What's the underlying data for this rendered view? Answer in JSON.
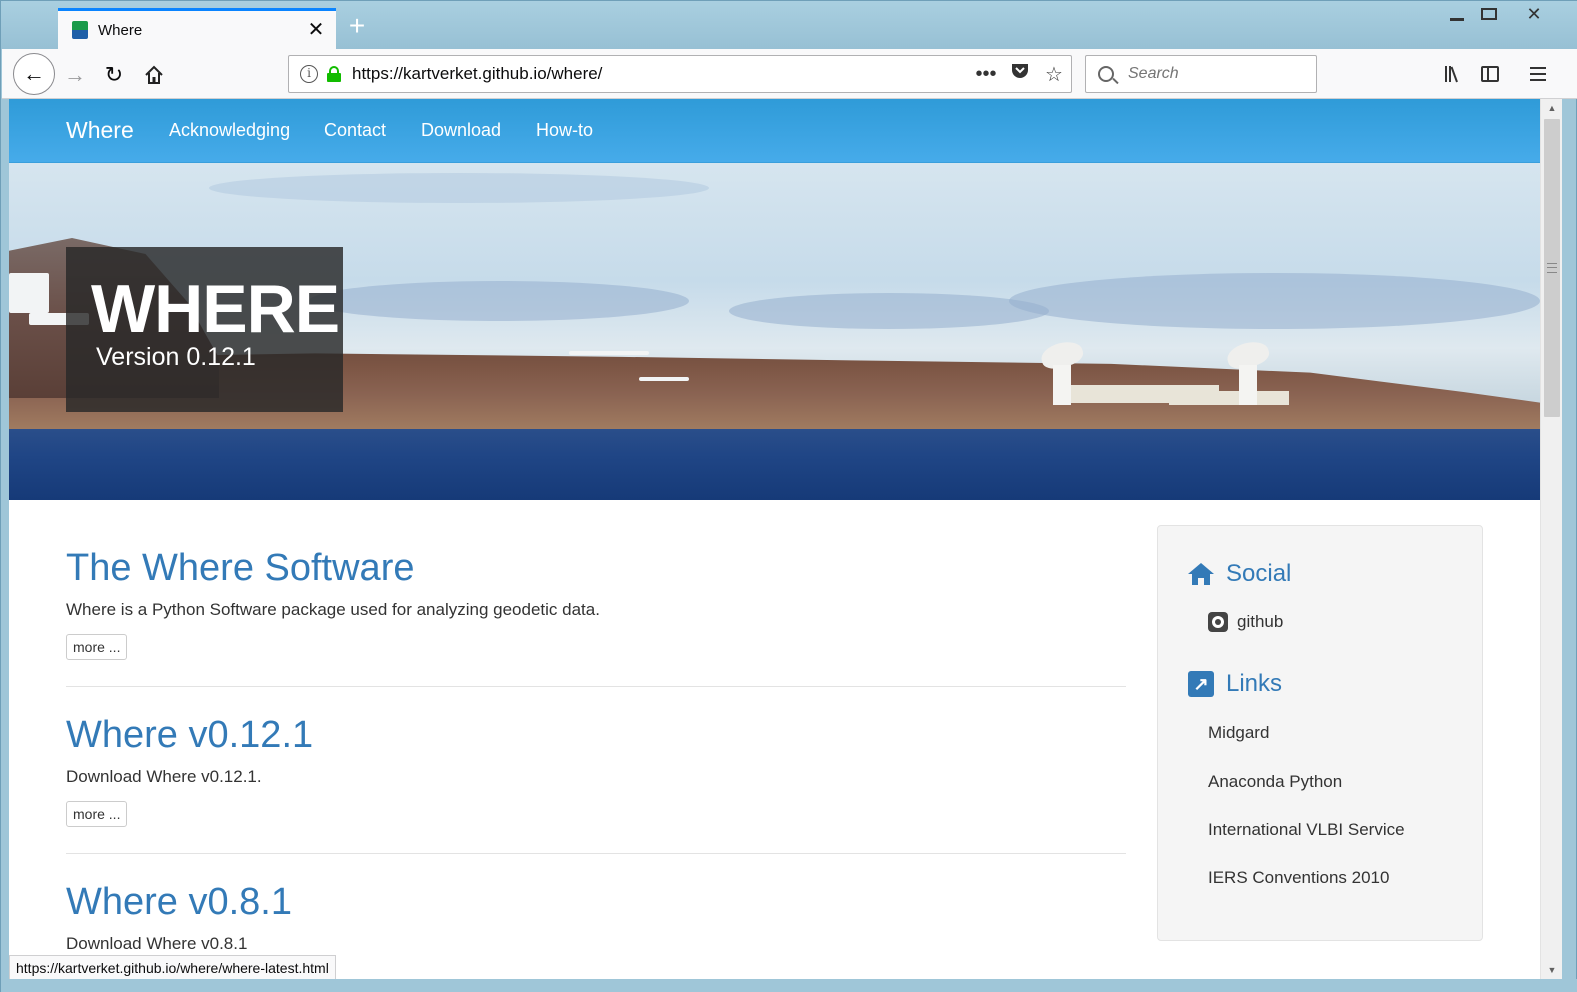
{
  "browser": {
    "tab_title": "Where",
    "tab_close": "✕",
    "new_tab": "+",
    "url": "https://kartverket.github.io/where/",
    "search_placeholder": "Search",
    "page_actions": "•••",
    "status_url": "https://kartverket.github.io/where/where-latest.html"
  },
  "site": {
    "brand": "Where",
    "nav": [
      "Acknowledging",
      "Contact",
      "Download",
      "How-to"
    ],
    "hero_title": "WHERE",
    "hero_version": "Version 0.12.1"
  },
  "posts": [
    {
      "title": "The Where Software",
      "excerpt": "Where is a Python Software package used for analyzing geodetic data.",
      "more": "more ..."
    },
    {
      "title": "Where v0.12.1",
      "excerpt": "Download Where v0.12.1.",
      "more": "more ..."
    },
    {
      "title": "Where v0.8.1",
      "excerpt": "Download Where v0.8.1"
    }
  ],
  "sidebar": {
    "social_heading": "Social",
    "social_items": [
      "github"
    ],
    "links_heading": "Links",
    "links": [
      "Midgard",
      "Anaconda Python",
      "International VLBI Service",
      "IERS Conventions 2010"
    ]
  },
  "colors": {
    "nav_blue": "#2f9bd8",
    "link_blue": "#337ab7",
    "tab_accent": "#0a84ff",
    "lock_green": "#12bc00"
  }
}
